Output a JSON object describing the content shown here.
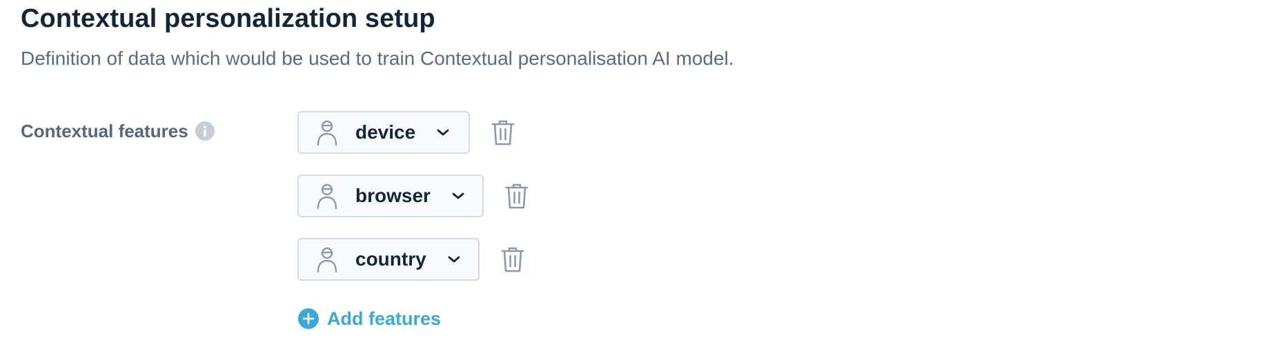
{
  "header": {
    "title": "Contextual personalization setup",
    "description": "Definition of data which would be used to train Contextual personalisation AI model."
  },
  "form": {
    "label": "Contextual features",
    "info_icon": "info-icon",
    "features": [
      {
        "value": "device",
        "icon": "user-icon"
      },
      {
        "value": "browser",
        "icon": "user-icon"
      },
      {
        "value": "country",
        "icon": "user-icon"
      }
    ],
    "add_label": "Add features"
  },
  "colors": {
    "text_primary": "#12263a",
    "text_secondary": "#5b6b80",
    "accent": "#3aa9d7",
    "icon_muted": "#8d99ab",
    "border": "#d3dbe7"
  }
}
